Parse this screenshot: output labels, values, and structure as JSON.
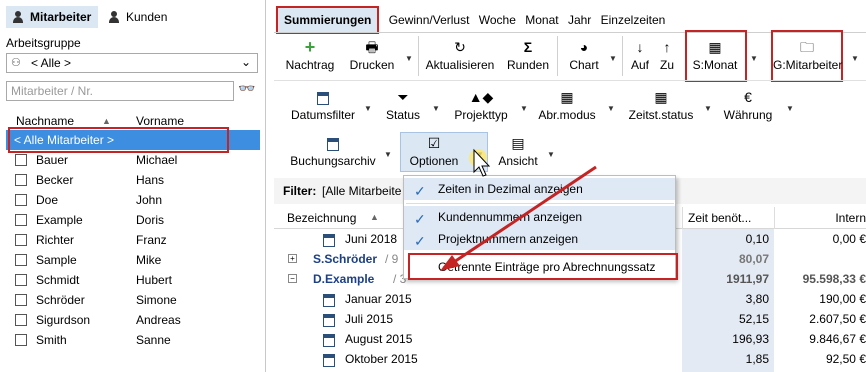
{
  "left": {
    "tabs": [
      "Mitarbeiter",
      "Kunden"
    ],
    "group_label": "Arbeitsgruppe",
    "group_value": "< Alle >",
    "search_placeholder": "Mitarbeiter / Nr.",
    "col_last": "Nachname",
    "col_first": "Vorname",
    "all_row": "< Alle Mitarbeiter >",
    "rows": [
      {
        "last": "Bauer",
        "first": "Michael"
      },
      {
        "last": "Becker",
        "first": "Hans"
      },
      {
        "last": "Doe",
        "first": "John"
      },
      {
        "last": "Example",
        "first": "Doris"
      },
      {
        "last": "Richter",
        "first": "Franz"
      },
      {
        "last": "Sample",
        "first": "Mike"
      },
      {
        "last": "Schmidt",
        "first": "Hubert"
      },
      {
        "last": "Schröder",
        "first": "Simone"
      },
      {
        "last": "Sigurdson",
        "first": "Andreas"
      },
      {
        "last": "Smith",
        "first": "Sanne"
      }
    ]
  },
  "tabs": [
    "Summierungen",
    "Gewinn/Verlust",
    "Woche",
    "Monat",
    "Jahr",
    "Einzelzeiten"
  ],
  "toolbar1": {
    "nachtrag": "Nachtrag",
    "drucken": "Drucken",
    "aktualisieren": "Aktualisieren",
    "runden": "Runden",
    "chart": "Chart",
    "auf": "Auf",
    "zu": "Zu",
    "smonat": "S:Monat",
    "gmitarbeiter": "G:Mitarbeiter"
  },
  "toolbar2": {
    "datumsfilter": "Datumsfilter",
    "status": "Status",
    "projekttyp": "Projekttyp",
    "abrmodus": "Abr.modus",
    "zeitststatus": "Zeitst.status",
    "waehrung": "Währung"
  },
  "toolbar3": {
    "buchungsarchiv": "Buchungsarchiv",
    "optionen": "Optionen",
    "ansicht": "Ansicht"
  },
  "filter": {
    "label": "Filter:",
    "value": "[Alle Mitarbeite"
  },
  "grid": {
    "col_bez": "Bezeichnung",
    "col_zeit": "Zeit benöt...",
    "col_intern": "Intern",
    "rows": [
      {
        "label": "Juni 2018",
        "zeit": "0,10",
        "intern": "0,00 €"
      },
      {
        "label": "S.Schröder",
        "suffix": "/ 9",
        "zeit": "80,07",
        "intern": ""
      },
      {
        "label": "D.Example",
        "suffix": "/ 3",
        "zeit": "1911,97",
        "intern": "95.598,33 €"
      },
      {
        "label": "Januar 2015",
        "zeit": "3,80",
        "intern": "190,00 €"
      },
      {
        "label": "Juli 2015",
        "zeit": "52,15",
        "intern": "2.607,50 €"
      },
      {
        "label": "August 2015",
        "zeit": "196,93",
        "intern": "9.846,67 €"
      },
      {
        "label": "Oktober 2015",
        "zeit": "1,85",
        "intern": "92,50 €"
      }
    ]
  },
  "menu": {
    "items": [
      "Zeiten in Dezimal anzeigen",
      "Kundennummern anzeigen",
      "Projektnummern anzeigen",
      "Getrennte Einträge pro Abrechnungssatz"
    ]
  },
  "colors": {
    "accent_red": "#c42424",
    "selection_blue": "#3d8ee0"
  }
}
